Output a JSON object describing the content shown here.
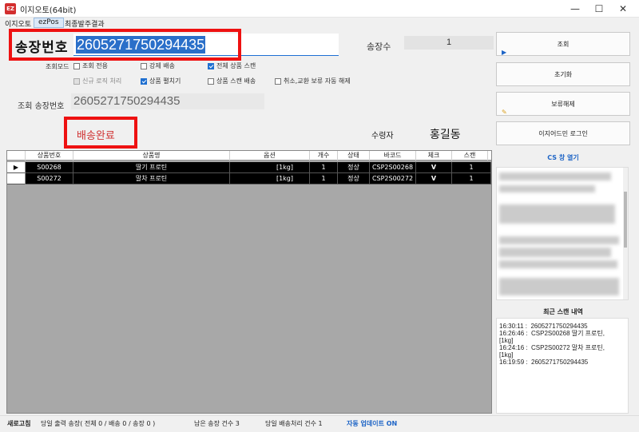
{
  "window": {
    "title": "이지오토(64bit)",
    "app_icon": "ez-logo-icon",
    "controls": [
      "—",
      "☐",
      "✕"
    ]
  },
  "menu": [
    "이지오토",
    "ezPos",
    "최종발주결과"
  ],
  "invoice": {
    "label": "송장번호",
    "value": "2605271750294435",
    "count_label": "송장수",
    "count_value": "1"
  },
  "mode": {
    "label": "조회모드",
    "options": [
      {
        "label": "조회 전용",
        "checked": false,
        "enabled": true
      },
      {
        "label": "강제 배송",
        "checked": false,
        "enabled": true
      },
      {
        "label": "전체 상품 스캔",
        "checked": true,
        "enabled": true
      },
      {
        "label": "신규 로직 처리",
        "checked": false,
        "enabled": false
      },
      {
        "label": "상품 펼치기",
        "checked": true,
        "enabled": true
      },
      {
        "label": "상품 스캔 배송",
        "checked": false,
        "enabled": true
      },
      {
        "label": "취소,교환 보류 자동 해제",
        "checked": false,
        "enabled": true
      }
    ]
  },
  "lookup": {
    "label": "조회 송장번호",
    "value": "2605271750294435"
  },
  "status": {
    "text": "배송완료",
    "recipient_label": "수령자",
    "recipient_name": "홍길동"
  },
  "grid": {
    "headers": [
      "상품번호",
      "상품명",
      "옵션",
      "개수",
      "상태",
      "바코드",
      "체크",
      "스캔"
    ],
    "rows": [
      {
        "marker": "▶",
        "cells": [
          "S00268",
          "딸기 프로틴",
          "[1kg]",
          "1",
          "정상",
          "CSP2S00268",
          "V",
          "1"
        ]
      },
      {
        "marker": "",
        "cells": [
          "S00272",
          "말차 프로틴",
          "[1kg]",
          "1",
          "정상",
          "CSP2S00272",
          "V",
          "1"
        ]
      }
    ]
  },
  "right_panel": {
    "buttons": [
      {
        "label": "조회",
        "icon": "arrow-right-icon"
      },
      {
        "label": "초기화",
        "icon": ""
      },
      {
        "label": "보류해제",
        "icon": "pencil-icon"
      },
      {
        "label": "이지어드민 로그인",
        "icon": ""
      }
    ],
    "cs_link": "CS 창 열기",
    "recent_title": "최근 스캔 내역",
    "recent_items": [
      "16:30:11 :  2605271750294435",
      "16:26:46 :  CSP2S00268 딸기 프로틴,\n[1kg]",
      "16:24:16 :  CSP2S00272 말차 프로틴,\n[1kg]",
      "16:19:59 :  2605271750294435"
    ]
  },
  "statusbar": {
    "refresh": "새로고침",
    "today_output": "당일 출력 송장( 전체 0 / 배송 0 / 송장 0 )",
    "remaining": "남은 송장 건수 3",
    "today_delivered": "당일 배송처리 건수 1",
    "auto_update": "자동 업데이트 ON"
  },
  "colors": {
    "highlight_red": "#ee1111",
    "status_red": "#d03030",
    "link_blue": "#1d64c6",
    "selection": "#2a6fc9"
  }
}
